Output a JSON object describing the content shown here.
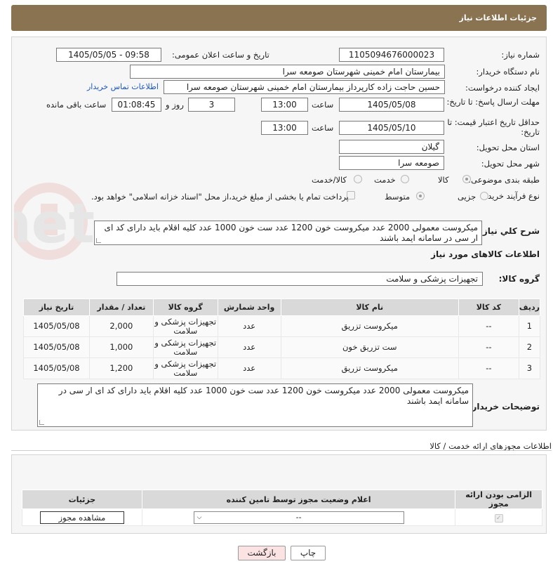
{
  "header": {
    "title": "جزئیات اطلاعات نیاز"
  },
  "form": {
    "need_number_label": "شماره نیاز:",
    "need_number": "1105094676000023",
    "announce_label": "تاریخ و ساعت اعلان عمومی:",
    "announce_value": "1405/05/05 - 09:58",
    "buyer_label": "نام دستگاه خریدار:",
    "buyer_value": "بیمارستان امام خمینی شهرستان صومعه سرا",
    "creator_label": "ایجاد کننده درخواست:",
    "creator_value": "حسین حاجت زاده کارپرداز بیمارستان امام خمینی شهرستان صومعه سرا",
    "contact_link": "اطلاعات تماس خریدار",
    "deadline_label": "مهلت ارسال پاسخ: تا تاریخ:",
    "deadline_date": "1405/05/08",
    "time_label": "ساعت",
    "deadline_time": "13:00",
    "days_value": "3",
    "days_label": "روز و",
    "remaining_value": "01:08:45",
    "remaining_label": "ساعت باقی مانده",
    "validity_label": "حداقل تاریخ اعتبار قیمت: تا تاریخ:",
    "validity_date": "1405/05/10",
    "validity_time": "13:00",
    "province_label": "استان محل تحویل:",
    "province_value": "گیلان",
    "city_label": "شهر محل تحویل:",
    "city_value": "صومعه سرا",
    "category_label": "طبقه بندی موضوعی:",
    "category_options": [
      "کالا",
      "خدمت",
      "کالا/خدمت"
    ],
    "category_selected": "کالا",
    "process_label": "نوع فرآیند خرید :",
    "process_options": [
      "جزیی",
      "متوسط"
    ],
    "process_selected": "متوسط",
    "payment_note": "پرداخت تمام یا بخشی از مبلغ خرید،از محل \"اسناد خزانه اسلامی\" خواهد بود.",
    "summary_label": "شرح کلي نياز:",
    "summary_value": "میکروست معمولی 2000 عدد میکروست خون 1200 عدد ست خون 1000 عدد کلیه اقلام باید دارای کد ای ار سی در سامانه ایمد باشند",
    "goods_info_title": "اطلاعات کالاهای مورد نیاز",
    "goods_group_label": "گروه کالا:",
    "goods_group_value": "تجهیزات پزشکی و سلامت",
    "buyer_notes_label": "توضیحات خریدار:",
    "buyer_notes_value": "میکروست معمولی 2000 عدد میکروست خون 1200 عدد ست خون 1000 عدد کلیه اقلام باید دارای کد ای ار سی در سامانه ایمد باشند"
  },
  "items_table": {
    "headers": [
      "ردیف",
      "کد کالا",
      "نام کالا",
      "واحد شمارش",
      "گروه کالا",
      "تعداد / مقدار",
      "تاریخ نیاز"
    ],
    "rows": [
      {
        "row": "1",
        "code": "--",
        "name": "میکروست تزریق",
        "unit": "عدد",
        "group": "تجهیزات پزشکی و سلامت",
        "qty": "2,000",
        "date": "1405/05/08"
      },
      {
        "row": "2",
        "code": "--",
        "name": "ست تزریق خون",
        "unit": "عدد",
        "group": "تجهیزات پزشکی و سلامت",
        "qty": "1,000",
        "date": "1405/05/08"
      },
      {
        "row": "3",
        "code": "--",
        "name": "میکروست تزریق",
        "unit": "عدد",
        "group": "تجهیزات پزشکی و سلامت",
        "qty": "1,200",
        "date": "1405/05/08"
      }
    ]
  },
  "permits": {
    "title": "اطلاعات مجوزهای ارائه خدمت / کالا",
    "headers": [
      "الزامی بودن ارائه مجوز",
      "اعلام وضعیت مجوز توسط تامین کننده",
      "جزئیات"
    ],
    "select_value": "--",
    "view_button": "مشاهده مجوز"
  },
  "buttons": {
    "print": "چاپ",
    "back": "بازگشت"
  },
  "watermark": {
    "text": "AriaTender.net"
  },
  "colors": {
    "header": "#8a7350",
    "link": "#1a56c4",
    "back_button": "#fbe3e3"
  }
}
